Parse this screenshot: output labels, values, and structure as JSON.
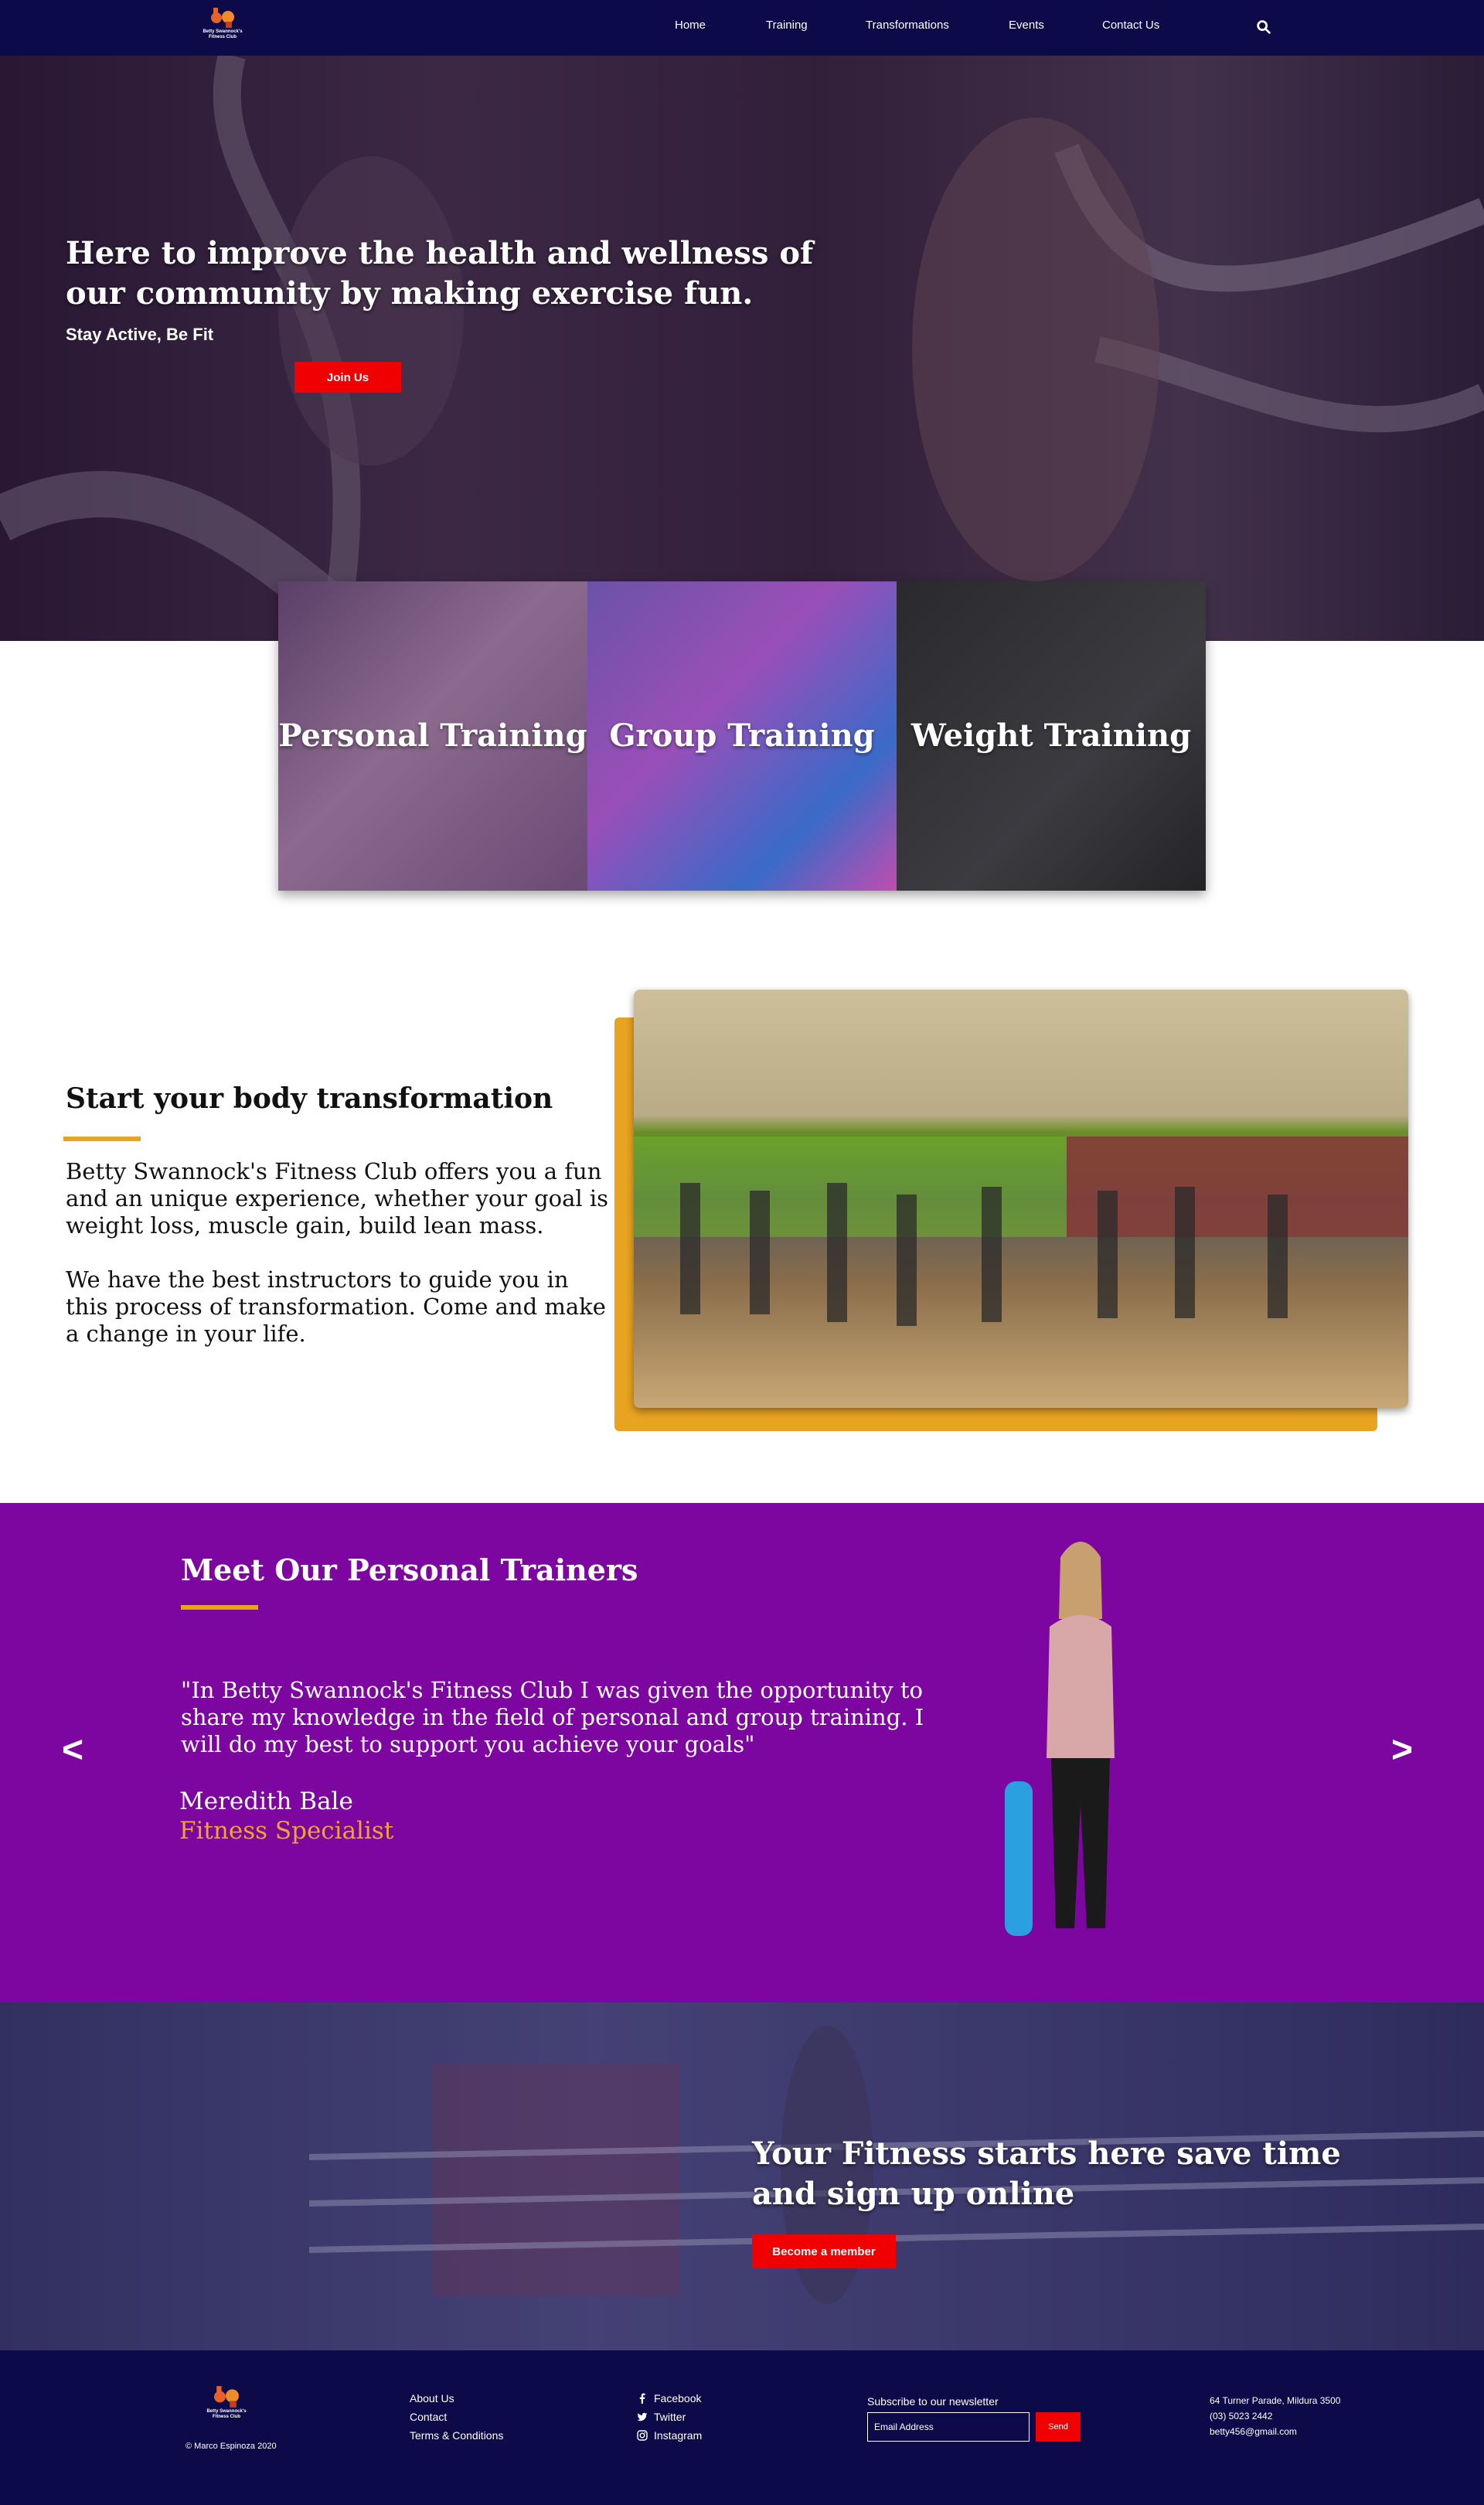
{
  "brand": {
    "logo_text": "Betty Swannock's Fitness Club",
    "accent": "#e8a321",
    "nav_bg": "#0d0a4a",
    "purple": "#7d06a0",
    "red": "#f00000"
  },
  "nav": {
    "items": [
      {
        "label": "Home"
      },
      {
        "label": "Training"
      },
      {
        "label": "Transformations"
      },
      {
        "label": "Events"
      },
      {
        "label": "Contact Us"
      }
    ],
    "search_icon": "search-icon"
  },
  "hero": {
    "headline": "Here to improve the health and wellness of our community by making exercise fun.",
    "subheadline": "Stay Active, Be Fit",
    "cta_label": "Join Us"
  },
  "programs": [
    {
      "label": "Personal Training"
    },
    {
      "label": "Group Training"
    },
    {
      "label": "Weight Training"
    }
  ],
  "transformation": {
    "title": "Start your body transformation",
    "paragraph_1": "Betty Swannock's Fitness Club offers you a fun and an unique experience, whether your goal is weight loss, muscle gain, build lean mass.",
    "paragraph_2": "We have the best instructors to guide you in this process of transformation. Come and make a change in your life."
  },
  "trainers": {
    "title": "Meet Our Personal Trainers",
    "quote": "\"In Betty Swannock's Fitness Club I was given the opportunity to share my knowledge in the field of personal and group training. I will do my best to support you achieve your goals\"",
    "name": "Meredith Bale",
    "role": "Fitness Specialist",
    "prev_label": "<",
    "next_label": ">"
  },
  "cta": {
    "headline": "Your Fitness starts here save time and sign up online",
    "button_label": "Become a member"
  },
  "footer": {
    "copyright": "© Marco Espinoza 2020",
    "links": [
      {
        "label": "About Us"
      },
      {
        "label": "Contact"
      },
      {
        "label": "Terms & Conditions"
      }
    ],
    "social": [
      {
        "label": "Facebook",
        "icon": "facebook-icon"
      },
      {
        "label": "Twitter",
        "icon": "twitter-icon"
      },
      {
        "label": "Instagram",
        "icon": "instagram-icon"
      }
    ],
    "newsletter_label": "Subscribe to our newsletter",
    "email_placeholder": "Email Address",
    "send_label": "Send",
    "address": "64 Turner Parade, Mildura 3500",
    "phone": "(03) 5023 2442",
    "email": "betty456@gmail.com"
  }
}
